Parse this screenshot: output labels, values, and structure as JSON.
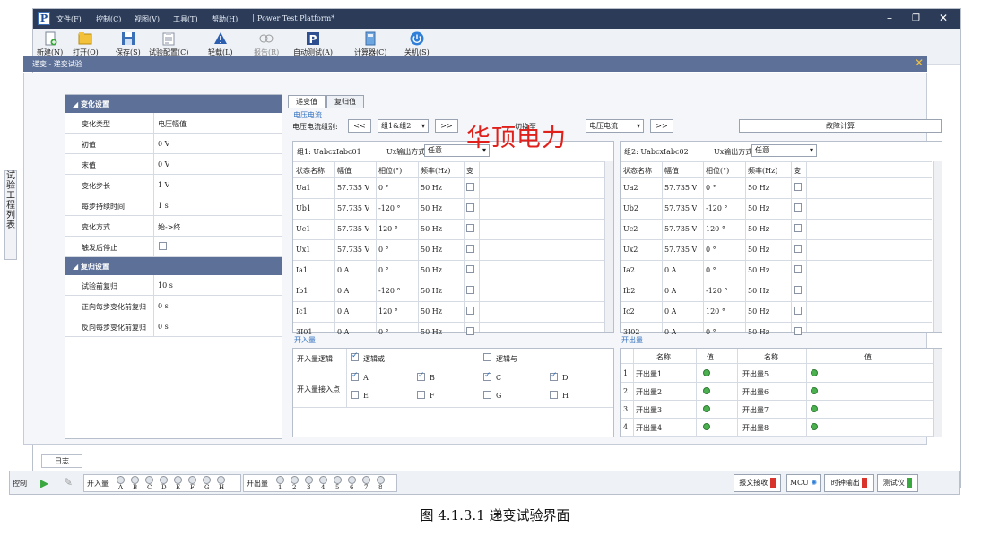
{
  "window": {
    "title": "Power Test Platform*"
  },
  "menu": [
    "文件(F)",
    "控制(C)",
    "视图(V)",
    "工具(T)",
    "帮助(H)"
  ],
  "toolbar": [
    {
      "label": "新建(N)",
      "icon": "new-icon"
    },
    {
      "label": "打开(O)",
      "icon": "open-icon"
    },
    {
      "label": "保存(S)",
      "icon": "save-icon"
    },
    {
      "label": "试验配置(C)",
      "icon": "config-icon"
    },
    {
      "label": "轻载(L)",
      "icon": "warning-icon"
    },
    {
      "label": "报告(R)",
      "icon": "report-icon"
    },
    {
      "label": "自动测试(A)",
      "icon": "auto-test-icon"
    },
    {
      "label": "计算器(C)",
      "icon": "calculator-icon"
    },
    {
      "label": "关机(S)",
      "icon": "power-icon"
    }
  ],
  "doc_tab": "递变 - 递变试验",
  "side_tab": [
    "试",
    "验",
    "工",
    "程",
    "列",
    "表"
  ],
  "props": {
    "section1": "变化设置",
    "rows1": [
      {
        "k": "变化类型",
        "v": "电压幅值"
      },
      {
        "k": "初值",
        "v": "0 V"
      },
      {
        "k": "末值",
        "v": "0 V"
      },
      {
        "k": "变化步长",
        "v": "1 V"
      },
      {
        "k": "每步持续时间",
        "v": "1 s"
      },
      {
        "k": "变化方式",
        "v": "始->终"
      },
      {
        "k": "触发后停止",
        "v": ""
      }
    ],
    "section2": "复归设置",
    "rows2": [
      {
        "k": "试验前复归",
        "v": "10 s"
      },
      {
        "k": "正向每步变化前复归",
        "v": "0 s"
      },
      {
        "k": "反向每步变化前复归",
        "v": "0 s"
      }
    ]
  },
  "tabs": [
    "递变值",
    "复归值"
  ],
  "vc": {
    "group_title": "电压电流",
    "group_label": "电压电流组别:",
    "prev": "<<",
    "group_sel": "组1&组2",
    "next": ">>",
    "mid_label": "切换至",
    "mode_sel": "电压电流",
    "fault_btn": "故障计算"
  },
  "g1": {
    "title": "组1: UabcxIabc01",
    "ux_label": "Ux输出方式:",
    "ux_val": "任意",
    "cols": [
      "状态名称",
      "幅值",
      "相位(°)",
      "频率(Hz)",
      "变"
    ],
    "rows": [
      [
        "Ua1",
        "57.735 V",
        "0 °",
        "50 Hz"
      ],
      [
        "Ub1",
        "57.735 V",
        "-120 °",
        "50 Hz"
      ],
      [
        "Uc1",
        "57.735 V",
        "120 °",
        "50 Hz"
      ],
      [
        "Ux1",
        "57.735 V",
        "0 °",
        "50 Hz"
      ],
      [
        "Ia1",
        "0 A",
        "0 °",
        "50 Hz"
      ],
      [
        "Ib1",
        "0 A",
        "-120 °",
        "50 Hz"
      ],
      [
        "Ic1",
        "0 A",
        "120 °",
        "50 Hz"
      ],
      [
        "3I01",
        "0 A",
        "0 °",
        "50 Hz"
      ]
    ]
  },
  "g2": {
    "title": "组2: UabcxIabc02",
    "ux_label": "Ux输出方式:",
    "ux_val": "任意",
    "cols": [
      "状态名称",
      "幅值",
      "相位(°)",
      "频率(Hz)",
      "变"
    ],
    "rows": [
      [
        "Ua2",
        "57.735 V",
        "0 °",
        "50 Hz"
      ],
      [
        "Ub2",
        "57.735 V",
        "-120 °",
        "50 Hz"
      ],
      [
        "Uc2",
        "57.735 V",
        "120 °",
        "50 Hz"
      ],
      [
        "Ux2",
        "57.735 V",
        "0 °",
        "50 Hz"
      ],
      [
        "Ia2",
        "0 A",
        "0 °",
        "50 Hz"
      ],
      [
        "Ib2",
        "0 A",
        "-120 °",
        "50 Hz"
      ],
      [
        "Ic2",
        "0 A",
        "120 °",
        "50 Hz"
      ],
      [
        "3I02",
        "0 A",
        "0 °",
        "50 Hz"
      ]
    ]
  },
  "bin": {
    "title": "开入量",
    "logic_label": "开入量逻辑",
    "logic_or": "逻辑或",
    "logic_and": "逻辑与",
    "points_label": "开入量接入点",
    "points": [
      "A",
      "B",
      "C",
      "D",
      "E",
      "F",
      "G",
      "H"
    ]
  },
  "bout": {
    "title": "开出量",
    "cols": [
      "名称",
      "值",
      "名称",
      "值"
    ],
    "rows": [
      {
        "n": "1",
        "a": "开出量1",
        "b": "开出量5"
      },
      {
        "n": "2",
        "a": "开出量2",
        "b": "开出量6"
      },
      {
        "n": "3",
        "a": "开出量3",
        "b": "开出量7"
      },
      {
        "n": "4",
        "a": "开出量4",
        "b": "开出量8"
      }
    ]
  },
  "log_tab": "日志",
  "status": {
    "control": "控制",
    "bin_label": "开入量",
    "bin_leds": [
      "A",
      "B",
      "C",
      "D",
      "E",
      "F",
      "G",
      "H"
    ],
    "bout_label": "开出量",
    "bout_leds": [
      "1",
      "2",
      "3",
      "4",
      "5",
      "6",
      "7",
      "8"
    ],
    "right": [
      "报文接收",
      "MCU",
      "时钟输出",
      "测试仪"
    ]
  },
  "brand": "华顶电力",
  "caption": "图 4.1.3.1 递变试验界面"
}
